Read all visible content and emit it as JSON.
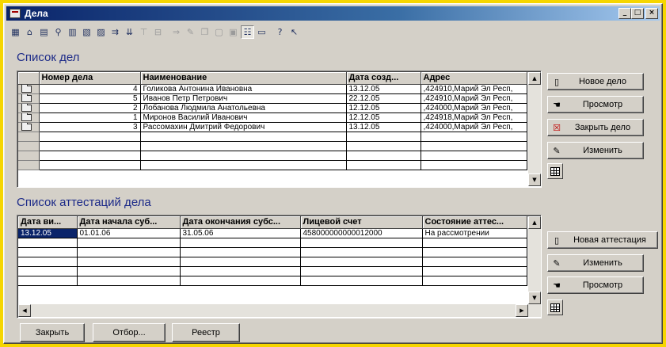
{
  "window": {
    "title": "Дела"
  },
  "toolbar": {
    "icons": [
      {
        "name": "calc-icon",
        "glyph": "▦"
      },
      {
        "name": "folder-open-icon",
        "glyph": "⌂"
      },
      {
        "name": "edit-record-icon",
        "glyph": "▤"
      },
      {
        "name": "find-icon",
        "glyph": "⚲"
      },
      {
        "name": "table-edit-icon",
        "glyph": "▥"
      },
      {
        "name": "record-delete-icon",
        "glyph": "▧"
      },
      {
        "name": "copy-record-icon",
        "glyph": "▨"
      },
      {
        "name": "move-icon",
        "glyph": "⇉"
      },
      {
        "name": "move-down-icon",
        "glyph": "⇊"
      },
      {
        "name": "filter-icon",
        "glyph": "⊤"
      },
      {
        "name": "print-icon",
        "glyph": "⊟"
      },
      {
        "name": "export-icon",
        "glyph": "⇒"
      },
      {
        "name": "tools-icon",
        "glyph": "✎"
      },
      {
        "name": "copy-icon",
        "glyph": "❐"
      },
      {
        "name": "page-icon",
        "glyph": "▢"
      },
      {
        "name": "page-image-icon",
        "glyph": "▣"
      },
      {
        "name": "tree-icon",
        "glyph": "☷"
      },
      {
        "name": "monitor-icon",
        "glyph": "▭"
      },
      {
        "name": "help-icon",
        "glyph": "?"
      },
      {
        "name": "whats-this-icon",
        "glyph": "↖"
      }
    ]
  },
  "cases": {
    "title": "Список дел",
    "columns": [
      "Номер дела",
      "Наименование",
      "Дата созд...",
      "Адрес"
    ],
    "rows": [
      [
        "4",
        "Голикова Антонина Ивановна",
        "13.12.05",
        ",424910,Марий Эл Респ,"
      ],
      [
        "5",
        "Иванов Петр Петрович",
        "22.12.05",
        ",424910,Марий Эл Респ,"
      ],
      [
        "2",
        "Лобанова Людмила Анатольевна",
        "12.12.05",
        ",424000,Марий Эл Респ,"
      ],
      [
        "1",
        "Миронов Василий Иванович",
        "12.12.05",
        ",424918,Марий Эл Респ,"
      ],
      [
        "3",
        "Рассомахин Дмитрий Федорович",
        "13.12.05",
        ",424000,Марий Эл Респ,"
      ]
    ],
    "buttons": {
      "new": "Новое дело",
      "view": "Просмотр",
      "close": "Закрыть дело",
      "edit": "Изменить"
    }
  },
  "attestations": {
    "title": "Список аттестаций дела",
    "columns": [
      "Дата ви...",
      "Дата начала суб...",
      "Дата окончания субс...",
      "Лицевой счет",
      "Состояние аттес..."
    ],
    "rows": [
      [
        "13.12.05",
        "01.01.06",
        "31.05.06",
        "458000000000012000",
        "На рассмотрении"
      ]
    ],
    "buttons": {
      "new": "Новая аттестация",
      "edit": "Изменить",
      "view": "Просмотр"
    }
  },
  "bottom": {
    "close": "Закрыть",
    "filter": "Отбор...",
    "registry": "Реестр"
  },
  "colors": {
    "selection": "#0a246a",
    "title": "#1c2a88",
    "background": "#f6d600"
  }
}
